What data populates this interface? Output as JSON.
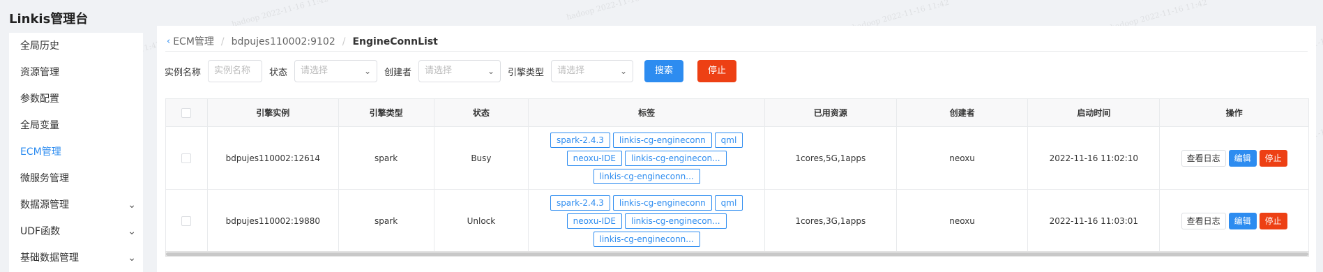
{
  "app": {
    "title": "Linkis管理台"
  },
  "sidebar": {
    "items": [
      {
        "label": "全局历史",
        "active": false,
        "expandable": false
      },
      {
        "label": "资源管理",
        "active": false,
        "expandable": false
      },
      {
        "label": "参数配置",
        "active": false,
        "expandable": false
      },
      {
        "label": "全局变量",
        "active": false,
        "expandable": false
      },
      {
        "label": "ECM管理",
        "active": true,
        "expandable": false
      },
      {
        "label": "微服务管理",
        "active": false,
        "expandable": false
      },
      {
        "label": "数据源管理",
        "active": false,
        "expandable": true
      },
      {
        "label": "UDF函数",
        "active": false,
        "expandable": true
      },
      {
        "label": "基础数据管理",
        "active": false,
        "expandable": true
      }
    ]
  },
  "breadcrumb": {
    "items": [
      "ECM管理",
      "bdpujes110002:9102",
      "EngineConnList"
    ]
  },
  "filters": {
    "instance_label": "实例名称",
    "instance_placeholder": "实例名称",
    "status_label": "状态",
    "status_placeholder": "请选择",
    "creator_label": "创建者",
    "creator_placeholder": "请选择",
    "engine_type_label": "引擎类型",
    "engine_type_placeholder": "请选择",
    "search_label": "搜索",
    "stop_label": "停止"
  },
  "table": {
    "headers": [
      "引擎实例",
      "引擎类型",
      "状态",
      "标签",
      "已用资源",
      "创建者",
      "启动时间",
      "操作"
    ],
    "rows": [
      {
        "instance": "bdpujes110002:12614",
        "type": "spark",
        "status": "Busy",
        "tags": [
          "spark-2.4.3",
          "linkis-cg-engineconn",
          "qml",
          "neoxu-IDE",
          "linkis-cg-enginecon...",
          "linkis-cg-engineconn..."
        ],
        "resources": "1cores,5G,1apps",
        "creator": "neoxu",
        "start_time": "2022-11-16 11:02:10"
      },
      {
        "instance": "bdpujes110002:19880",
        "type": "spark",
        "status": "Unlock",
        "tags": [
          "spark-2.4.3",
          "linkis-cg-engineconn",
          "qml",
          "neoxu-IDE",
          "linkis-cg-enginecon...",
          "linkis-cg-engineconn..."
        ],
        "resources": "1cores,3G,1apps",
        "creator": "neoxu",
        "start_time": "2022-11-16 11:03:01"
      }
    ],
    "actions": {
      "log": "查看日志",
      "edit": "编辑",
      "stop": "停止"
    }
  },
  "watermark": "hadoop 2022-11-16 11:42",
  "colors": {
    "primary": "#2d8cf0",
    "danger": "#ed4014",
    "border": "#e8eaec",
    "bg": "#f0f2f5"
  },
  "icons": {
    "back": "chevron-left-icon",
    "select_arrow": "chevron-down-icon",
    "expand": "chevron-down-icon"
  }
}
